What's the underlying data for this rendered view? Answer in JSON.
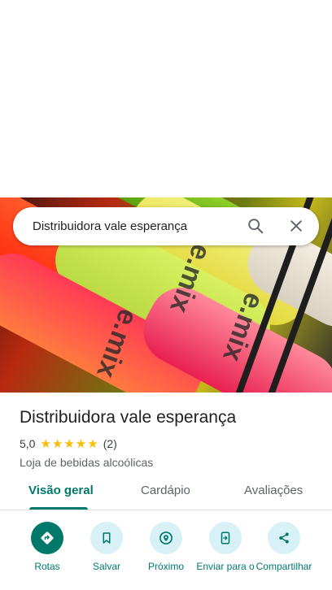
{
  "search": {
    "query": "Distribuidora vale esperança"
  },
  "place": {
    "title": "Distribuidora vale esperança",
    "rating": "5,0",
    "stars": "★★★★★",
    "review_count": "(2)",
    "category": "Loja de bebidas alcoólicas"
  },
  "tabs": [
    {
      "label": "Visão geral",
      "active": true
    },
    {
      "label": "Cardápio",
      "active": false
    },
    {
      "label": "Avaliações",
      "active": false
    }
  ],
  "actions": [
    {
      "label": "Rotas",
      "icon": "directions-icon"
    },
    {
      "label": "Salvar",
      "icon": "bookmark-icon"
    },
    {
      "label": "Próximo",
      "icon": "nearby-icon"
    },
    {
      "label": "Enviar para o",
      "icon": "send-to-phone-icon"
    },
    {
      "label": "Compartilhar",
      "icon": "share-icon"
    }
  ],
  "colors": {
    "accent": "#00796b",
    "chip": "#d7f1f6",
    "star": "#fbbc04"
  }
}
